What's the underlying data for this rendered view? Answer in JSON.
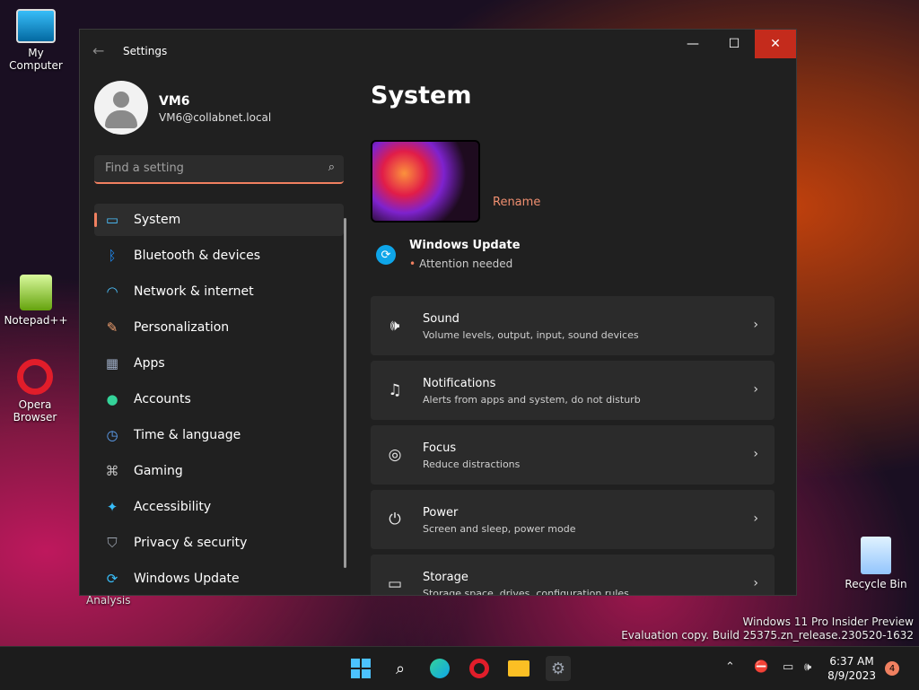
{
  "desktop": {
    "icons": [
      {
        "label": "My Computer"
      },
      {
        "label": "Notepad++"
      },
      {
        "label": "Opera Browser"
      },
      {
        "label": "Recycle Bin"
      }
    ],
    "analysis_label": "Analysis",
    "watermark_line1": "Windows 11 Pro Insider Preview",
    "watermark_line2": "Evaluation copy. Build 25375.zn_release.230520-1632"
  },
  "window": {
    "title": "Settings",
    "back_icon": "arrow-left-icon",
    "minimize_glyph": "—",
    "maximize_glyph": "☐",
    "close_glyph": "✕"
  },
  "profile": {
    "name": "VM6",
    "email": "VM6@collabnet.local"
  },
  "search": {
    "placeholder": "Find a setting"
  },
  "nav": {
    "items": [
      {
        "label": "System",
        "icon": "monitor-icon",
        "glyph": "▭",
        "color": "#4cc2ff"
      },
      {
        "label": "Bluetooth & devices",
        "icon": "bluetooth-icon",
        "glyph": "ᛒ",
        "color": "#1e90ff"
      },
      {
        "label": "Network & internet",
        "icon": "wifi-icon",
        "glyph": "◠",
        "color": "#4cc2ff"
      },
      {
        "label": "Personalization",
        "icon": "brush-icon",
        "glyph": "✎",
        "color": "#f0a070"
      },
      {
        "label": "Apps",
        "icon": "apps-icon",
        "glyph": "▦",
        "color": "#9aa8c0"
      },
      {
        "label": "Accounts",
        "icon": "person-icon",
        "glyph": "●",
        "color": "#34d399"
      },
      {
        "label": "Time & language",
        "icon": "clock-globe-icon",
        "glyph": "◷",
        "color": "#60a5fa"
      },
      {
        "label": "Gaming",
        "icon": "gamepad-icon",
        "glyph": "⌘",
        "color": "#c0c0c0"
      },
      {
        "label": "Accessibility",
        "icon": "accessibility-icon",
        "glyph": "✦",
        "color": "#38bdf8"
      },
      {
        "label": "Privacy & security",
        "icon": "shield-icon",
        "glyph": "⛉",
        "color": "#9ca3af"
      },
      {
        "label": "Windows Update",
        "icon": "update-icon",
        "glyph": "⟳",
        "color": "#38bdf8"
      }
    ],
    "active_index": 0
  },
  "main": {
    "title": "System",
    "rename_label": "Rename",
    "update": {
      "title": "Windows Update",
      "status": "Attention needed"
    },
    "cards": [
      {
        "title": "Sound",
        "subtitle": "Volume levels, output, input, sound devices",
        "icon": "speaker-icon",
        "glyph": "🕪"
      },
      {
        "title": "Notifications",
        "subtitle": "Alerts from apps and system, do not disturb",
        "icon": "bell-icon",
        "glyph": "♫"
      },
      {
        "title": "Focus",
        "subtitle": "Reduce distractions",
        "icon": "focus-icon",
        "glyph": "◎"
      },
      {
        "title": "Power",
        "subtitle": "Screen and sleep, power mode",
        "icon": "power-icon",
        "glyph": "⏻"
      },
      {
        "title": "Storage",
        "subtitle": "Storage space, drives, configuration rules",
        "icon": "drive-icon",
        "glyph": "▭"
      }
    ]
  },
  "taskbar": {
    "time": "6:37 AM",
    "date": "8/9/2023",
    "notification_count": "4"
  },
  "colors": {
    "accent": "#f08060",
    "window_bg": "#202020",
    "card_bg": "#2b2b2b"
  }
}
